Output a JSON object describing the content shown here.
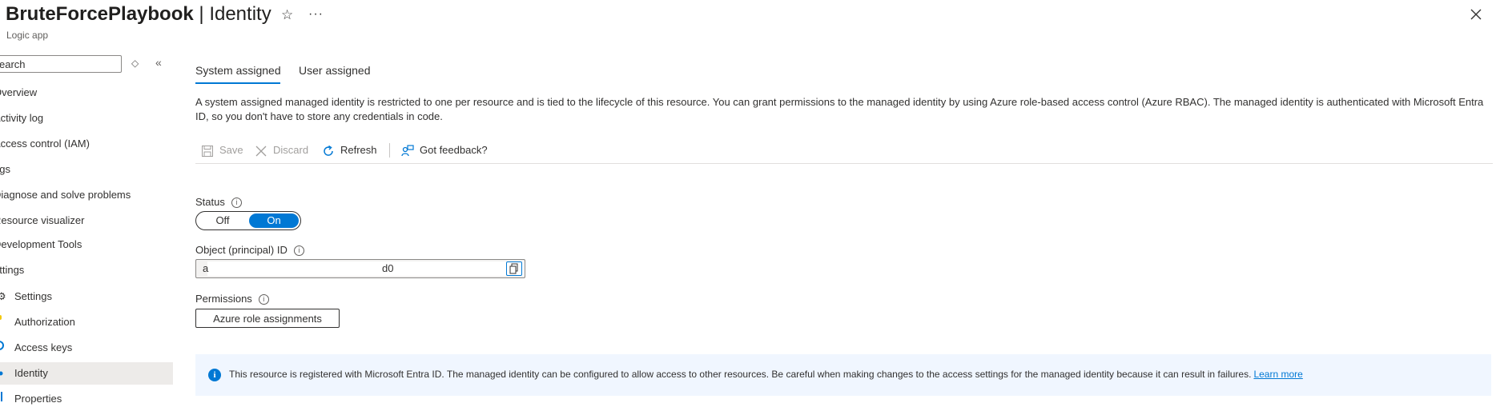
{
  "header": {
    "resource_name": "BruteForcePlaybook",
    "separator": " | ",
    "page": "Identity",
    "subtitle": "Logic app",
    "favorite_icon": "star-icon",
    "more_icon": "more-icon",
    "close_icon": "close-icon"
  },
  "sidebar": {
    "search_placeholder": "earch",
    "items": [
      {
        "label": "Overview"
      },
      {
        "label": "Activity log"
      },
      {
        "label": "Access control (IAM)"
      },
      {
        "label": "ags"
      },
      {
        "label": "Diagnose and solve problems"
      },
      {
        "label": "Resource visualizer"
      },
      {
        "label": "Development Tools"
      },
      {
        "label": "ettings"
      },
      {
        "label": "Settings",
        "icon": "gear-icon"
      },
      {
        "label": "Authorization",
        "icon": "key-icon"
      },
      {
        "label": "Access keys",
        "icon": "access-keys-icon"
      },
      {
        "label": "Identity",
        "icon": "identity-icon",
        "selected": true
      },
      {
        "label": "Properties",
        "icon": "properties-icon"
      }
    ]
  },
  "tabs": [
    {
      "label": "System assigned",
      "active": true
    },
    {
      "label": "User assigned",
      "active": false
    }
  ],
  "description": "A system assigned managed identity is restricted to one per resource and is tied to the lifecycle of this resource. You can grant permissions to the managed identity by using Azure role-based access control (Azure RBAC). The managed identity is authenticated with Microsoft Entra ID, so you don't have to store any credentials in code.",
  "toolbar": {
    "save": "Save",
    "discard": "Discard",
    "refresh": "Refresh",
    "feedback": "Got feedback?"
  },
  "status": {
    "label": "Status",
    "off": "Off",
    "on": "On",
    "value": "On"
  },
  "object_id": {
    "label": "Object (principal) ID",
    "value_start": "a",
    "value_end": "d0"
  },
  "permissions": {
    "label": "Permissions",
    "button": "Azure role assignments"
  },
  "banner": {
    "text": "This resource is registered with Microsoft Entra ID. The managed identity can be configured to allow access to other resources. Be careful when making changes to the access settings for the managed identity because it can result in failures.",
    "link": "Learn more"
  },
  "colors": {
    "accent": "#0078d4",
    "selected_nav": "#edebe9",
    "banner_bg": "#f0f6ff"
  }
}
